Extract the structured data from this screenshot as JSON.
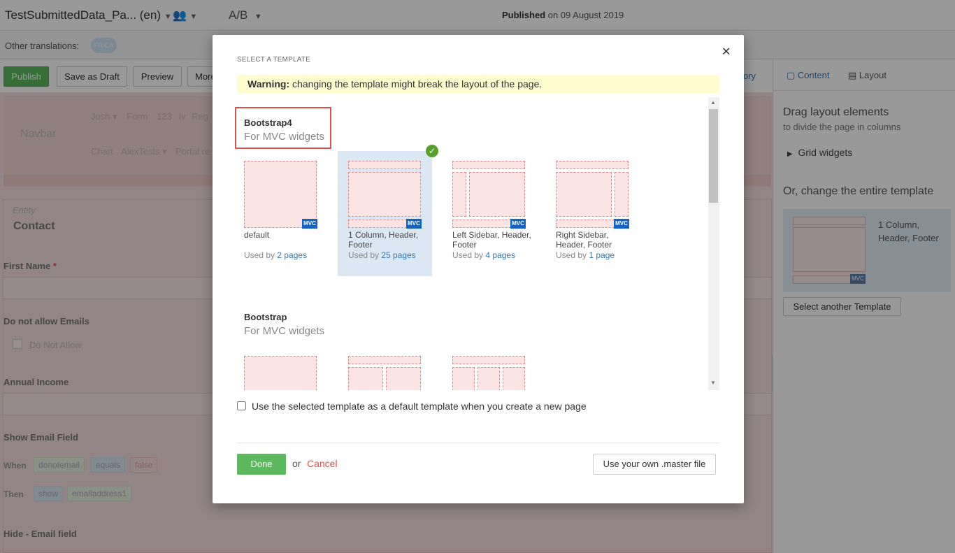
{
  "topbar": {
    "page_title": "TestSubmittedData_Pa... (en)",
    "users_icon": "users-icon",
    "ab_label": "A/B",
    "published_label": "Published",
    "published_date": " on 09 August 2019"
  },
  "translations": {
    "label": "Other translations:",
    "chip": "FR-CA"
  },
  "toolbar": {
    "publish": "Publish",
    "save_draft": "Save as Draft",
    "preview": "Preview",
    "more": "More",
    "history_fragment": "ory"
  },
  "canvas": {
    "navbar_brand": "Navbar",
    "nav_items_row1": [
      "Josh ▾",
      "Form",
      "123",
      "lv",
      "Reg"
    ],
    "nav_items_row2": [
      "Chart",
      "AlexTests ▾",
      "Portal re"
    ],
    "entity_label": "Entity",
    "form_title": "Contact",
    "first_name_label": "First Name",
    "required_mark": "*",
    "no_emails_label": "Do not allow Emails",
    "no_emails_checkbox": "Do Not Allow",
    "annual_income_label": "Annual Income",
    "show_email_label": "Show Email Field",
    "when_label": "When",
    "when_tags": [
      "donotemail",
      "equals",
      "false"
    ],
    "then_label": "Then",
    "then_tags": [
      "show",
      "emailaddress1"
    ],
    "hide_email_label": "Hide - Email field"
  },
  "right_panel": {
    "tab_content": "Content",
    "tab_layout": "Layout",
    "drag_heading": "Drag layout elements",
    "drag_sub": "to divide the page in columns",
    "grid_widgets": "Grid widgets",
    "change_heading": "Or, change the entire template",
    "current_template_line1": "1 Column,",
    "current_template_line2": "Header, Footer",
    "current_template_badge": "MVC",
    "select_button": "Select another Template"
  },
  "modal": {
    "heading": "SELECT A TEMPLATE",
    "close": "✕",
    "warning_bold": "Warning:",
    "warning_text": " changing the template might break the layout of the page.",
    "groups": [
      {
        "title": "Bootstrap4",
        "subtitle": "For MVC widgets",
        "templates": [
          {
            "name": "default",
            "used_prefix": "Used by ",
            "used_link": "2 pages",
            "badge": "MVC"
          },
          {
            "name": "1 Column, Header, Footer",
            "used_prefix": "Used by ",
            "used_link": "25 pages",
            "badge": "MVC",
            "selected": true
          },
          {
            "name": "Left Sidebar, Header, Footer",
            "used_prefix": "Used by ",
            "used_link": "4 pages",
            "badge": "MVC"
          },
          {
            "name": "Right Sidebar, Header, Footer",
            "used_prefix": "Used by ",
            "used_link": "1 page",
            "badge": "MVC"
          }
        ]
      },
      {
        "title": "Bootstrap",
        "subtitle": "For MVC widgets"
      }
    ],
    "selected_icon": "check-circle-icon",
    "default_checkbox_label": "Use the selected template as a default template when you create a new page",
    "done": "Done",
    "or": "or",
    "cancel": "Cancel",
    "use_master": "Use your own .master file"
  }
}
